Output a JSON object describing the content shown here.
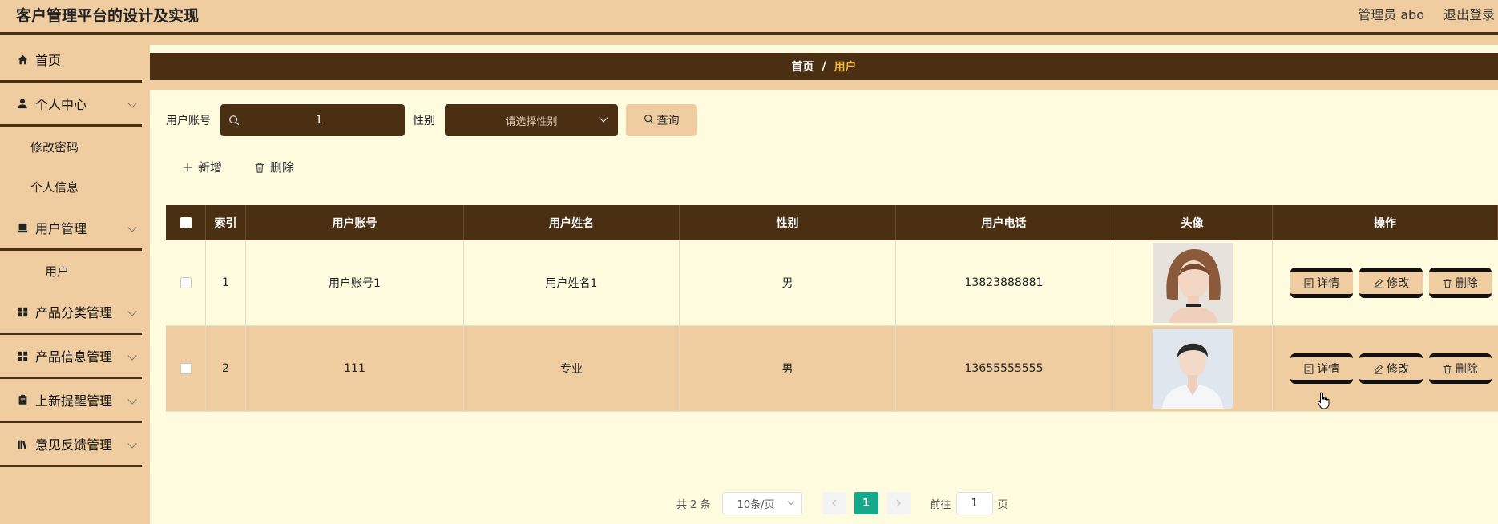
{
  "header": {
    "app_title": "客户管理平台的设计及实现",
    "user_label": "管理员 abo",
    "logout_label": "退出登录"
  },
  "sidebar": {
    "items": [
      {
        "label": "首页",
        "icon": "home-icon"
      },
      {
        "label": "个人中心",
        "icon": "person-icon",
        "expanded": true,
        "children": [
          "修改密码",
          "个人信息"
        ]
      },
      {
        "label": "用户管理",
        "icon": "user-manage-icon",
        "expanded": true,
        "children": [
          "用户"
        ]
      },
      {
        "label": "产品分类管理",
        "icon": "grid-icon"
      },
      {
        "label": "产品信息管理",
        "icon": "grid-icon"
      },
      {
        "label": "上新提醒管理",
        "icon": "clipboard-icon"
      },
      {
        "label": "意见反馈管理",
        "icon": "books-icon"
      }
    ]
  },
  "breadcrumb": {
    "home": "首页",
    "separator": "/",
    "current": "用户"
  },
  "search": {
    "account_label": "用户账号",
    "account_value": "1",
    "gender_label": "性别",
    "gender_placeholder": "请选择性别",
    "query_label": "查询"
  },
  "actions": {
    "add_label": "新增",
    "delete_label": "删除"
  },
  "table": {
    "headers": [
      "索引",
      "用户账号",
      "用户姓名",
      "性别",
      "用户电话",
      "头像",
      "操作"
    ],
    "rows": [
      {
        "index": "1",
        "account": "用户账号1",
        "name": "用户姓名1",
        "gender": "男",
        "phone": "13823888881",
        "avatar": "female-avatar"
      },
      {
        "index": "2",
        "account": "111",
        "name": "专业",
        "gender": "男",
        "phone": "13655555555",
        "avatar": "male-avatar"
      }
    ],
    "row_actions": {
      "detail": "详情",
      "edit": "修改",
      "delete": "删除"
    }
  },
  "pagination": {
    "total": "共 2 条",
    "page_size": "10条/页",
    "current_page": "1",
    "goto_prefix": "前往",
    "goto_value": "1",
    "goto_suffix": "页"
  },
  "colors": {
    "accent_dark": "#4a2f12",
    "accent_light": "#f0cda0",
    "background": "#fefbdf",
    "highlight": "#f0b53b",
    "page_active": "#16a88b"
  }
}
